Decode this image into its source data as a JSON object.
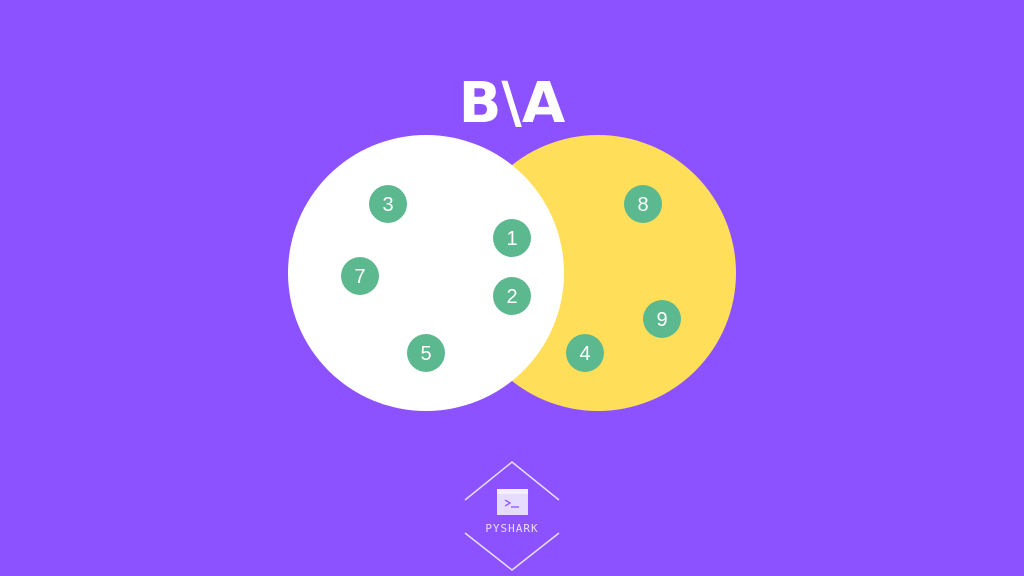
{
  "title": "B\\A",
  "colors": {
    "background": "#8c52ff",
    "set_a": "#ffffff",
    "set_b": "#ffde59",
    "element": "#5cb88f",
    "element_text": "#ffffff",
    "logo": "#e6dcff"
  },
  "sets": {
    "a": {
      "elements": [
        "3",
        "1",
        "7",
        "2",
        "5"
      ]
    },
    "b_only": {
      "elements": [
        "8",
        "9",
        "4"
      ]
    }
  },
  "logo": {
    "text": "PYSHARK",
    "icon": "terminal-window-icon"
  }
}
